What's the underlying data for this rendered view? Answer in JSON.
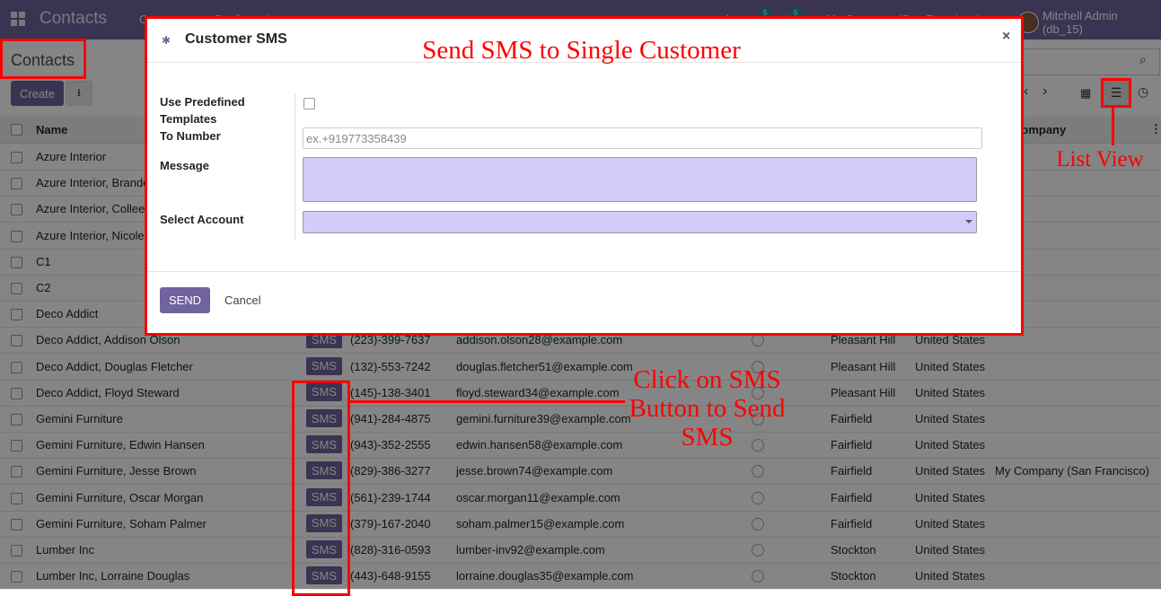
{
  "topbar": {
    "app_title": "Contacts",
    "menu_1": "Contacts",
    "menu_2": "Configuration",
    "chat_count": "5",
    "activity_count": "5",
    "company_switch": "My Company (San Francisco)",
    "user_name": "Mitchell Admin (db_15)"
  },
  "control": {
    "breadcrumb": "Contacts",
    "create_label": "Create",
    "download_icon": "download-icon"
  },
  "table": {
    "headers": {
      "name": "Name",
      "company": "Company"
    },
    "sms_label": "SMS",
    "rows": [
      {
        "name": "Azure Interior",
        "phone": "",
        "email": "",
        "city": "",
        "country": "",
        "company": ""
      },
      {
        "name": "Azure Interior, Brandon Freeman",
        "phone": "",
        "email": "",
        "city": "",
        "country": "",
        "company": ""
      },
      {
        "name": "Azure Interior, Colleen Diaz",
        "phone": "",
        "email": "",
        "city": "",
        "country": "",
        "company": ""
      },
      {
        "name": "Azure Interior, Nicole Ford",
        "phone": "",
        "email": "",
        "city": "",
        "country": "",
        "company": ""
      },
      {
        "name": "C1",
        "phone": "",
        "email": "",
        "city": "",
        "country": "",
        "company": ""
      },
      {
        "name": "C2",
        "phone": "",
        "email": "",
        "city": "",
        "country": "",
        "company": ""
      },
      {
        "name": "Deco Addict",
        "phone": "",
        "email": "",
        "city": "",
        "country": "",
        "company": ""
      },
      {
        "name": "Deco Addict, Addison Olson",
        "phone": "(223)-399-7637",
        "email": "addison.olson28@example.com",
        "city": "Pleasant Hill",
        "country": "United States",
        "company": ""
      },
      {
        "name": "Deco Addict, Douglas Fletcher",
        "phone": "(132)-553-7242",
        "email": "douglas.fletcher51@example.com",
        "city": "Pleasant Hill",
        "country": "United States",
        "company": ""
      },
      {
        "name": "Deco Addict, Floyd Steward",
        "phone": "(145)-138-3401",
        "email": "floyd.steward34@example.com",
        "city": "Pleasant Hill",
        "country": "United States",
        "company": ""
      },
      {
        "name": "Gemini Furniture",
        "phone": "(941)-284-4875",
        "email": "gemini.furniture39@example.com",
        "city": "Fairfield",
        "country": "United States",
        "company": ""
      },
      {
        "name": "Gemini Furniture, Edwin Hansen",
        "phone": "(943)-352-2555",
        "email": "edwin.hansen58@example.com",
        "city": "Fairfield",
        "country": "United States",
        "company": ""
      },
      {
        "name": "Gemini Furniture, Jesse Brown",
        "phone": "(829)-386-3277",
        "email": "jesse.brown74@example.com",
        "city": "Fairfield",
        "country": "United States",
        "company": "My Company (San Francisco)"
      },
      {
        "name": "Gemini Furniture, Oscar Morgan",
        "phone": "(561)-239-1744",
        "email": "oscar.morgan11@example.com",
        "city": "Fairfield",
        "country": "United States",
        "company": ""
      },
      {
        "name": "Gemini Furniture, Soham Palmer",
        "phone": "(379)-167-2040",
        "email": "soham.palmer15@example.com",
        "city": "Fairfield",
        "country": "United States",
        "company": ""
      },
      {
        "name": "Lumber Inc",
        "phone": "(828)-316-0593",
        "email": "lumber-inv92@example.com",
        "city": "Stockton",
        "country": "United States",
        "company": ""
      },
      {
        "name": "Lumber Inc, Lorraine Douglas",
        "phone": "(443)-648-9155",
        "email": "lorraine.douglas35@example.com",
        "city": "Stockton",
        "country": "United States",
        "company": ""
      }
    ]
  },
  "modal": {
    "title": "Customer SMS",
    "label_predefined": "Use Predefined Templates",
    "label_to": "To Number",
    "to_placeholder": "ex.+919773358439",
    "label_message": "Message",
    "label_account": "Select Account",
    "send_label": "SEND",
    "cancel_label": "Cancel"
  },
  "annotations": {
    "headline": "Send SMS to Single Customer",
    "list_view": "List View",
    "click_sms": "Click on SMS Button to Send SMS",
    "color": "#ff0000"
  },
  "colors": {
    "brand": "#71639e",
    "field_highlight": "#d2ccfa"
  }
}
